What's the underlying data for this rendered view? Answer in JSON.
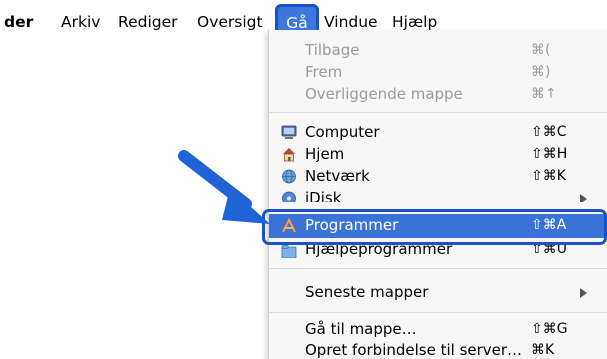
{
  "menubar": {
    "items": [
      "der",
      "Arkiv",
      "Rediger",
      "Oversigt",
      "Gå",
      "Vindue",
      "Hjælp"
    ],
    "active": "Gå"
  },
  "menu": {
    "rows": [
      {
        "label": "Tilbage",
        "shortcut": "⌘(",
        "enabled": false
      },
      {
        "label": "Frem",
        "shortcut": "⌘)",
        "enabled": false
      },
      {
        "label": "Overliggende mappe",
        "shortcut": "⌘↑",
        "enabled": false
      },
      {
        "label": "Computer",
        "shortcut": "⇧⌘C",
        "icon": "computer-icon",
        "enabled": true
      },
      {
        "label": "Hjem",
        "shortcut": "⇧⌘H",
        "icon": "home-icon",
        "enabled": true
      },
      {
        "label": "Netværk",
        "shortcut": "⇧⌘K",
        "icon": "network-icon",
        "enabled": true
      },
      {
        "label": "iDisk",
        "shortcut": "",
        "icon": "idisk-icon",
        "submenu": true,
        "enabled": true
      },
      {
        "label": "Programmer",
        "shortcut": "⇧⌘A",
        "icon": "applications-icon",
        "highlighted": true
      },
      {
        "label": "Hjælpeprogrammer",
        "shortcut": "⇧⌘U",
        "icon": "utilities-folder-icon",
        "enabled": true
      },
      {
        "label": "Seneste mapper",
        "shortcut": "",
        "submenu": true,
        "enabled": true
      },
      {
        "label": "Gå til mappe…",
        "shortcut": "⇧⌘G",
        "enabled": true
      },
      {
        "label": "Opret forbindelse til server…",
        "shortcut": "⌘K",
        "enabled": true
      }
    ]
  },
  "colors": {
    "highlight": "#3a72d8",
    "callout": "#1a52c8",
    "arrow": "#1f63d6"
  }
}
